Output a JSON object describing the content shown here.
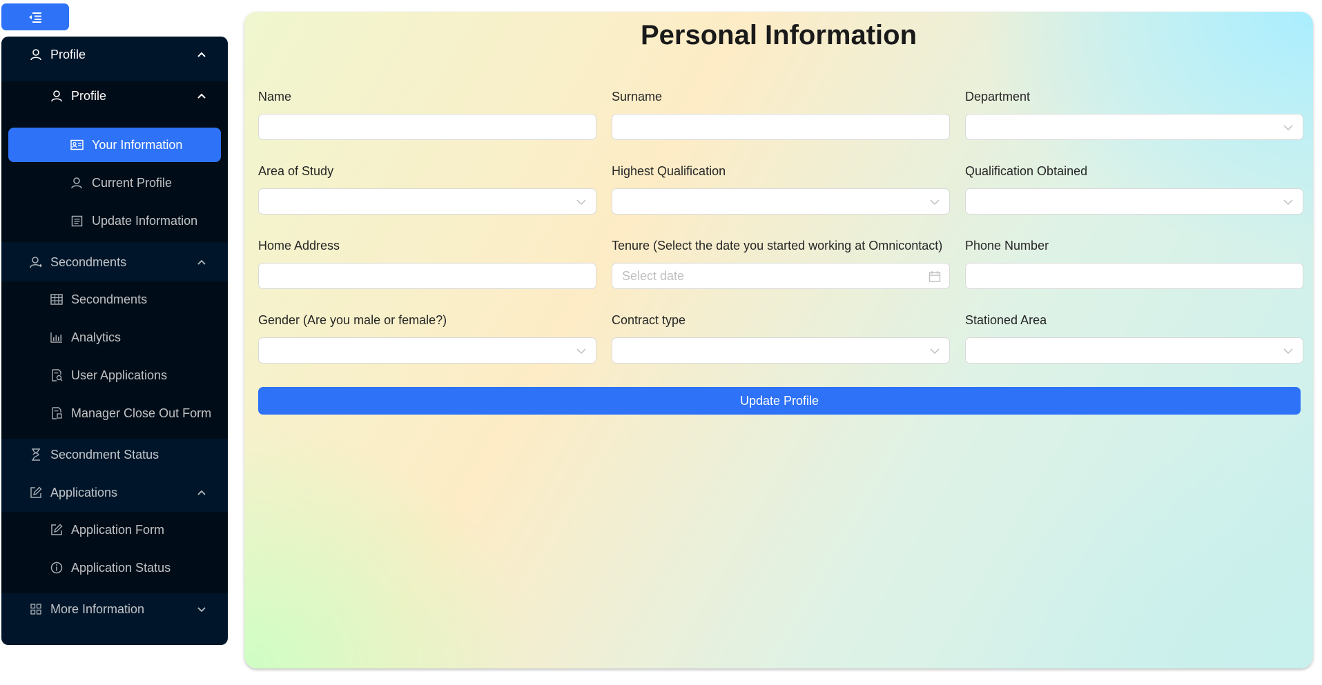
{
  "sidebar": {
    "profile_group": "Profile",
    "profile_sub": "Profile",
    "your_information": "Your Information",
    "current_profile": "Current Profile",
    "update_information": "Update Information",
    "secondments_group": "Secondments",
    "secondments": "Secondments",
    "analytics": "Analytics",
    "user_applications": "User Applications",
    "manager_close_out": "Manager Close Out Form",
    "secondment_status": "Secondment Status",
    "applications_group": "Applications",
    "application_form": "Application Form",
    "application_status": "Application Status",
    "more_information": "More Information"
  },
  "form": {
    "title": "Personal Information",
    "fields": {
      "name": {
        "label": "Name",
        "value": ""
      },
      "surname": {
        "label": "Surname",
        "value": ""
      },
      "department": {
        "label": "Department",
        "value": ""
      },
      "area_of_study": {
        "label": "Area of Study",
        "value": ""
      },
      "highest_qualification": {
        "label": "Highest Qualification",
        "value": ""
      },
      "qualification_obtained": {
        "label": "Qualification Obtained",
        "value": ""
      },
      "home_address": {
        "label": "Home Address",
        "value": ""
      },
      "tenure": {
        "label": "Tenure (Select the date you started working at Omnicontact)",
        "placeholder": "Select date"
      },
      "phone_number": {
        "label": "Phone Number",
        "value": ""
      },
      "gender": {
        "label": "Gender (Are you male or female?)",
        "value": ""
      },
      "contract_type": {
        "label": "Contract type",
        "value": ""
      },
      "stationed_area": {
        "label": "Stationed Area",
        "value": ""
      }
    },
    "submit_label": "Update Profile"
  },
  "colors": {
    "accent": "#2d72f7",
    "sidebar_bg": "#001529",
    "submenu_bg": "#000c17"
  }
}
